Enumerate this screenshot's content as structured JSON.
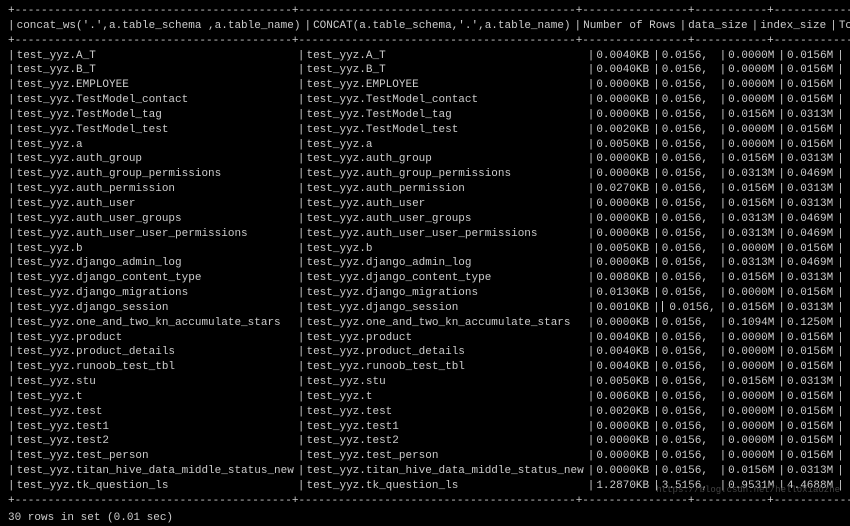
{
  "headers": {
    "col1": "concat_ws('.',a.table_schema ,a.table_name)",
    "col2": "CONCAT(a.table_schema,'.',a.table_name)",
    "col3": "Number of Rows",
    "col4": "data_size",
    "col5": "index_size",
    "col6": "Total"
  },
  "separator_top": "+------------------------------------------+------------------------------------------+----------------+-----------+------------+---------+",
  "rows": [
    {
      "c1": "test_yyz.A_T",
      "c2": "test_yyz.A_T",
      "c3": "0.0040KB",
      "c4": "0.0156,",
      "c5": "0.0000M",
      "c6": "0.0156M"
    },
    {
      "c1": "test_yyz.B_T",
      "c2": "test_yyz.B_T",
      "c3": "0.0040KB",
      "c4": "0.0156,",
      "c5": "0.0000M",
      "c6": "0.0156M"
    },
    {
      "c1": "test_yyz.EMPLOYEE",
      "c2": "test_yyz.EMPLOYEE",
      "c3": "0.0000KB",
      "c4": "0.0156,",
      "c5": "0.0000M",
      "c6": "0.0156M"
    },
    {
      "c1": "test_yyz.TestModel_contact",
      "c2": "test_yyz.TestModel_contact",
      "c3": "0.0000KB",
      "c4": "0.0156,",
      "c5": "0.0000M",
      "c6": "0.0156M"
    },
    {
      "c1": "test_yyz.TestModel_tag",
      "c2": "test_yyz.TestModel_tag",
      "c3": "0.0000KB",
      "c4": "0.0156,",
      "c5": "0.0156M",
      "c6": "0.0313M"
    },
    {
      "c1": "test_yyz.TestModel_test",
      "c2": "test_yyz.TestModel_test",
      "c3": "0.0020KB",
      "c4": "0.0156,",
      "c5": "0.0000M",
      "c6": "0.0156M"
    },
    {
      "c1": "test_yyz.a",
      "c2": "test_yyz.a",
      "c3": "0.0050KB",
      "c4": "0.0156,",
      "c5": "0.0000M",
      "c6": "0.0156M"
    },
    {
      "c1": "test_yyz.auth_group",
      "c2": "test_yyz.auth_group",
      "c3": "0.0000KB",
      "c4": "0.0156,",
      "c5": "0.0156M",
      "c6": "0.0313M"
    },
    {
      "c1": "test_yyz.auth_group_permissions",
      "c2": "test_yyz.auth_group_permissions",
      "c3": "0.0000KB",
      "c4": "0.0156,",
      "c5": "0.0313M",
      "c6": "0.0469M"
    },
    {
      "c1": "test_yyz.auth_permission",
      "c2": "test_yyz.auth_permission",
      "c3": "0.0270KB",
      "c4": "0.0156,",
      "c5": "0.0156M",
      "c6": "0.0313M"
    },
    {
      "c1": "test_yyz.auth_user",
      "c2": "test_yyz.auth_user",
      "c3": "0.0000KB",
      "c4": "0.0156,",
      "c5": "0.0156M",
      "c6": "0.0313M"
    },
    {
      "c1": "test_yyz.auth_user_groups",
      "c2": "test_yyz.auth_user_groups",
      "c3": "0.0000KB",
      "c4": "0.0156,",
      "c5": "0.0313M",
      "c6": "0.0469M"
    },
    {
      "c1": "test_yyz.auth_user_user_permissions",
      "c2": "test_yyz.auth_user_user_permissions",
      "c3": "0.0000KB",
      "c4": "0.0156,",
      "c5": "0.0313M",
      "c6": "0.0469M"
    },
    {
      "c1": "test_yyz.b",
      "c2": "test_yyz.b",
      "c3": "0.0050KB",
      "c4": "0.0156,",
      "c5": "0.0000M",
      "c6": "0.0156M"
    },
    {
      "c1": "test_yyz.django_admin_log",
      "c2": "test_yyz.django_admin_log",
      "c3": "0.0000KB",
      "c4": "0.0156,",
      "c5": "0.0313M",
      "c6": "0.0469M"
    },
    {
      "c1": "test_yyz.django_content_type",
      "c2": "test_yyz.django_content_type",
      "c3": "0.0080KB",
      "c4": "0.0156,",
      "c5": "0.0156M",
      "c6": "0.0313M"
    },
    {
      "c1": "test_yyz.django_migrations",
      "c2": "test_yyz.django_migrations",
      "c3": "0.0130KB",
      "c4": "0.0156,",
      "c5": "0.0000M",
      "c6": "0.0156M"
    },
    {
      "c1": "test_yyz.django_session",
      "c2": "test_yyz.django_session",
      "c3": "0.0010KB",
      "c4": "0.0156,",
      "c5": "0.0156M",
      "c6": "0.0313M",
      "cursor": true
    },
    {
      "c1": "test_yyz.one_and_two_kn_accumulate_stars",
      "c2": "test_yyz.one_and_two_kn_accumulate_stars",
      "c3": "0.0000KB",
      "c4": "0.0156,",
      "c5": "0.1094M",
      "c6": "0.1250M"
    },
    {
      "c1": "test_yyz.product",
      "c2": "test_yyz.product",
      "c3": "0.0040KB",
      "c4": "0.0156,",
      "c5": "0.0000M",
      "c6": "0.0156M"
    },
    {
      "c1": "test_yyz.product_details",
      "c2": "test_yyz.product_details",
      "c3": "0.0040KB",
      "c4": "0.0156,",
      "c5": "0.0000M",
      "c6": "0.0156M"
    },
    {
      "c1": "test_yyz.runoob_test_tbl",
      "c2": "test_yyz.runoob_test_tbl",
      "c3": "0.0040KB",
      "c4": "0.0156,",
      "c5": "0.0000M",
      "c6": "0.0156M"
    },
    {
      "c1": "test_yyz.stu",
      "c2": "test_yyz.stu",
      "c3": "0.0050KB",
      "c4": "0.0156,",
      "c5": "0.0156M",
      "c6": "0.0313M"
    },
    {
      "c1": "test_yyz.t",
      "c2": "test_yyz.t",
      "c3": "0.0060KB",
      "c4": "0.0156,",
      "c5": "0.0000M",
      "c6": "0.0156M"
    },
    {
      "c1": "test_yyz.test",
      "c2": "test_yyz.test",
      "c3": "0.0020KB",
      "c4": "0.0156,",
      "c5": "0.0000M",
      "c6": "0.0156M"
    },
    {
      "c1": "test_yyz.test1",
      "c2": "test_yyz.test1",
      "c3": "0.0000KB",
      "c4": "0.0156,",
      "c5": "0.0000M",
      "c6": "0.0156M"
    },
    {
      "c1": "test_yyz.test2",
      "c2": "test_yyz.test2",
      "c3": "0.0000KB",
      "c4": "0.0156,",
      "c5": "0.0000M",
      "c6": "0.0156M"
    },
    {
      "c1": "test_yyz.test_person",
      "c2": "test_yyz.test_person",
      "c3": "0.0000KB",
      "c4": "0.0156,",
      "c5": "0.0000M",
      "c6": "0.0156M"
    },
    {
      "c1": "test_yyz.titan_hive_data_middle_status_new",
      "c2": "test_yyz.titan_hive_data_middle_status_new",
      "c3": "0.0000KB",
      "c4": "0.0156,",
      "c5": "0.0156M",
      "c6": "0.0313M"
    },
    {
      "c1": "test_yyz.tk_question_ls",
      "c2": "test_yyz.tk_question_ls",
      "c3": "1.2870KB",
      "c4": "3.5156,",
      "c5": "0.9531M",
      "c6": "4.4688M"
    }
  ],
  "footer": "30 rows in set (0.01 sec)",
  "watermark": "https://blog.csdn.net/helloxiaozhe"
}
